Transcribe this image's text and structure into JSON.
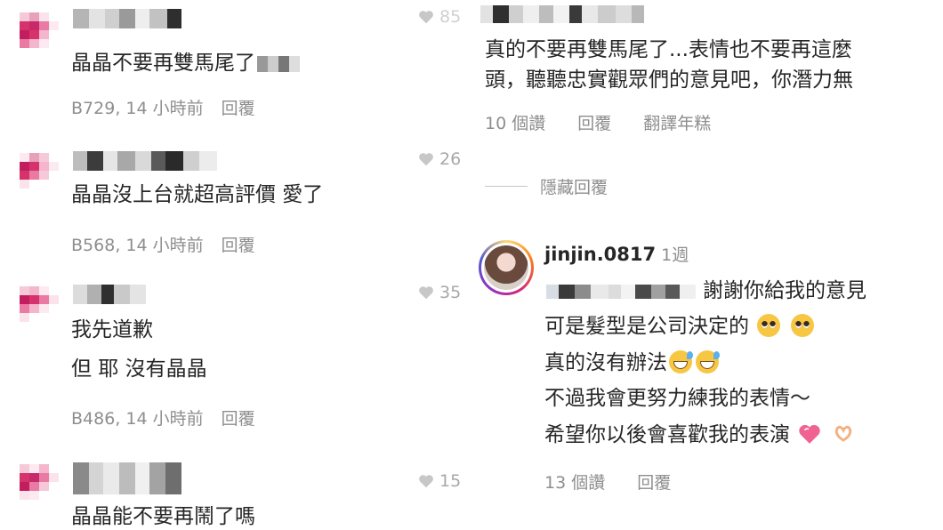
{
  "left_comments": [
    {
      "text_lines": [
        "晶晶不要再雙馬尾了"
      ],
      "meta": {
        "user_id": "B729",
        "time": "14 小時前",
        "reply": "回覆"
      }
    },
    {
      "text_lines": [
        "晶晶沒上台就超高評價 愛了"
      ],
      "meta": {
        "user_id": "B568",
        "time": "14 小時前",
        "reply": "回覆"
      }
    },
    {
      "text_lines": [
        "我先道歉",
        "但 耶 沒有晶晶"
      ],
      "meta": {
        "user_id": "B486",
        "time": "14 小時前",
        "reply": "回覆"
      }
    },
    {
      "text_lines": [
        "晶晶能不要再鬧了嗎"
      ]
    }
  ],
  "likes": {
    "top": "85",
    "second": "26",
    "third": "35",
    "fourth": "15"
  },
  "main_comment": {
    "line1": "真的不要再雙馬尾了...表情也不要再這麼",
    "line2": "頭，聽聽忠實觀眾們的意見吧，你潛力無",
    "likes": "10 個讚",
    "reply": "回覆",
    "translate": "翻譯年糕"
  },
  "hidden_replies_label": "隱藏回覆",
  "reply": {
    "username": "jinjin.0817",
    "ago": "1週",
    "line1_tail": "謝謝你給我的意見",
    "line2": "可是髮型是公司決定的",
    "line3": "真的沒有辦法",
    "line4": "不過我會更努力練我的表情～",
    "line5": "希望你以後會喜歡我的表演",
    "likes": "13 個讚",
    "reply_label": "回覆"
  },
  "colors": {
    "text": "#262626",
    "muted": "#8e8e8e",
    "like_icon": "#c7c7c7",
    "avatar_pink": "#d6336c"
  },
  "icons": [
    "heart-icon",
    "pleading-face-emoji",
    "sweat-smile-emoji",
    "pink-heart-emoji",
    "heart-hands-emoji"
  ]
}
